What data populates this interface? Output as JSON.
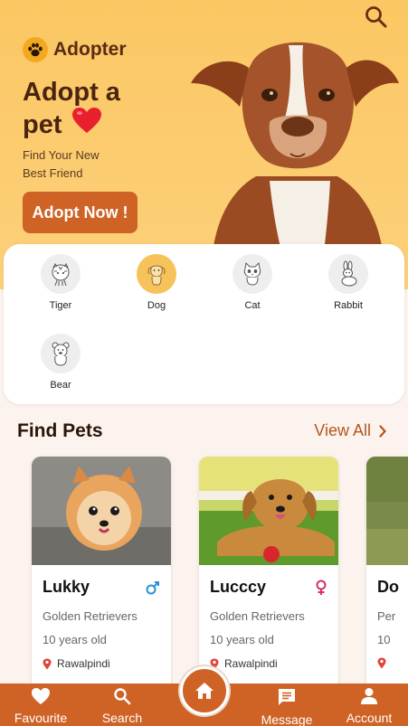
{
  "header": {
    "brand_name": "Adopter",
    "title": "Adopt a pet",
    "subtitle": "Find Your New Best Friend",
    "cta_label": "Adopt Now !"
  },
  "categories": [
    {
      "label": "Tiger",
      "icon": "tiger-icon",
      "selected": false
    },
    {
      "label": "Dog",
      "icon": "dog-icon",
      "selected": true
    },
    {
      "label": "Cat",
      "icon": "cat-icon",
      "selected": false
    },
    {
      "label": "Rabbit",
      "icon": "rabbit-icon",
      "selected": false
    },
    {
      "label": "Bear",
      "icon": "bear-icon",
      "selected": false
    }
  ],
  "find_pets": {
    "title": "Find Pets",
    "view_all_label": "View All",
    "pets": [
      {
        "name": "Lukky",
        "gender": "male",
        "breed": "Golden Retrievers",
        "age": "10 years old",
        "location": "Rawalpindi"
      },
      {
        "name": "Lucccy",
        "gender": "female",
        "breed": "Golden Retrievers",
        "age": "10 years old",
        "location": "Rawalpindi"
      },
      {
        "name": "Do",
        "gender": "",
        "breed": "Per",
        "age": "10",
        "location": ""
      }
    ]
  },
  "bottom_nav": {
    "items": [
      {
        "label": "Favourite",
        "icon": "heart-icon"
      },
      {
        "label": "Search",
        "icon": "search-icon"
      },
      {
        "label": "",
        "icon": "home-icon"
      },
      {
        "label": "Message",
        "icon": "message-icon"
      },
      {
        "label": "Account",
        "icon": "person-icon"
      }
    ]
  },
  "colors": {
    "accent": "#cf6325",
    "hero_bg": "#fbc763",
    "selected_category": "#f7c25a",
    "male": "#2a8fd8",
    "female": "#d0316f",
    "location_pin": "#e0453a"
  }
}
